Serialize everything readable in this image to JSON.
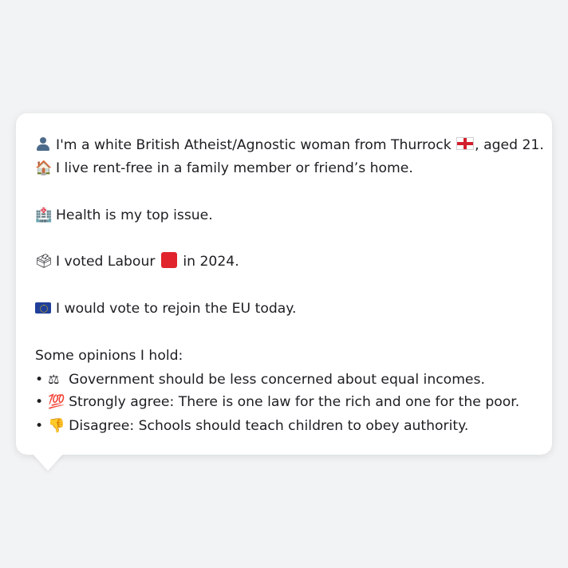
{
  "persona": {
    "line1_text": "I'm a white British Atheist/Agnostic woman from Thurrock",
    "line1_suffix": ", aged 21.",
    "line2_text": "I live rent-free in a family member or friend’s home.",
    "line3_text": "Health is my top issue.",
    "line4_text_a": "I voted Labour",
    "line4_text_b": "in 2024.",
    "line5_text": "I would vote to rejoin the EU today.",
    "opinions_heading": "Some opinions I hold:",
    "opinions": [
      "Government should be less concerned about equal incomes.",
      "Strongly agree: There is one law for the rich and one for the poor.",
      "Disagree: Schools should teach children to obey authority."
    ],
    "bullet": "•"
  },
  "icons": {
    "line1": "person-silhouette-icon",
    "flag": "england-flag-icon",
    "line2": "house-icon",
    "line3": "hospital-icon",
    "line4": "ballot-box-icon",
    "party": "red-square-icon",
    "line5": "eu-flag-icon",
    "opinion1": "scales-icon",
    "opinion2": "hundred-points-icon",
    "opinion3": "thumbs-down-icon"
  },
  "colors": {
    "background": "#f2f3f5",
    "bubble": "#ffffff",
    "text": "#1c1e21",
    "labour_red": "#e0232c",
    "eu_blue": "#1f3f99"
  }
}
